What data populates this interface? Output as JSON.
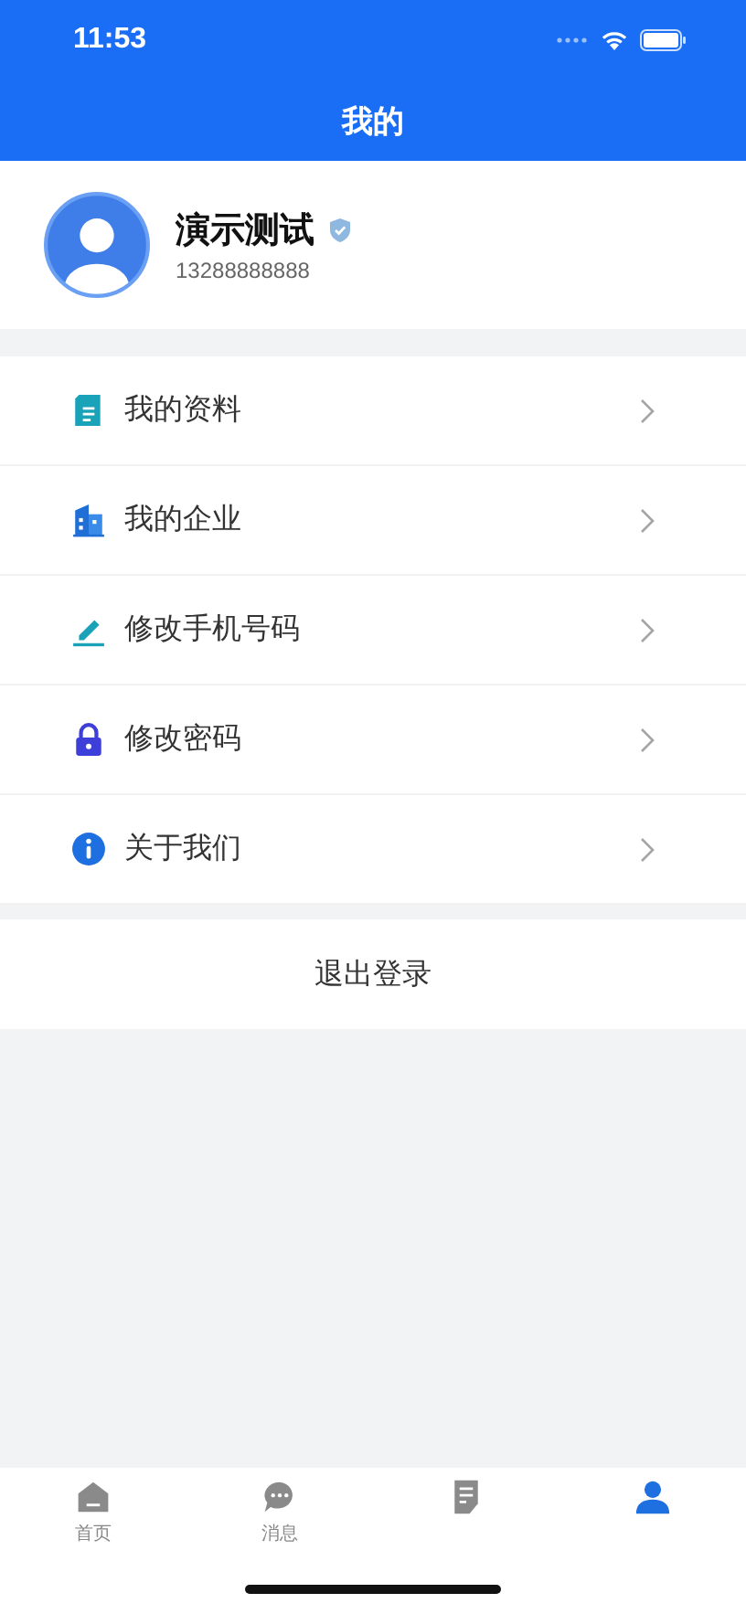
{
  "status_bar": {
    "time": "11:53"
  },
  "nav": {
    "title": "我的"
  },
  "profile": {
    "name": "演示测试",
    "verified": true,
    "phone": "13288888888"
  },
  "menu": [
    {
      "kind": "document",
      "label": "我的资料"
    },
    {
      "kind": "building",
      "label": "我的企业"
    },
    {
      "kind": "pencil",
      "label": "修改手机号码"
    },
    {
      "kind": "lock",
      "label": "修改密码"
    },
    {
      "kind": "info",
      "label": "关于我们"
    }
  ],
  "logout": {
    "label": "退出登录"
  },
  "tab_bar": [
    {
      "kind": "home",
      "label": "首页",
      "selected": false
    },
    {
      "kind": "message",
      "label": "消息",
      "selected": false
    },
    {
      "kind": "document",
      "selected": false
    },
    {
      "kind": "person",
      "selected": true
    }
  ]
}
